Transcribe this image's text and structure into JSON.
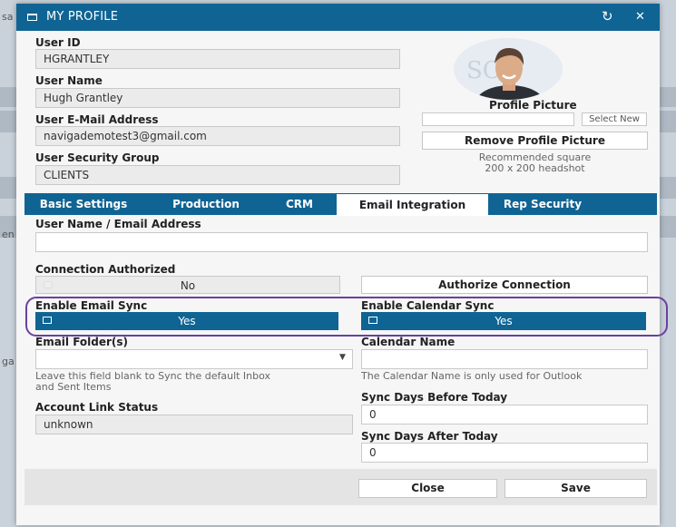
{
  "background": {
    "ghost_text_1": "sa",
    "ghost_text_2": "en",
    "ghost_text_3": "ga"
  },
  "dialog": {
    "title": "MY PROFILE",
    "refresh_icon": "↻",
    "close_icon": "✕"
  },
  "profile": {
    "user_id_label": "User ID",
    "user_id": "HGRANTLEY",
    "user_name_label": "User Name",
    "user_name": "Hugh Grantley",
    "email_label": "User E-Mail Address",
    "email": "navigademotest3@gmail.com",
    "security_group_label": "User Security Group",
    "security_group": "CLIENTS"
  },
  "picture": {
    "label": "Profile Picture",
    "select_new": "Select New",
    "remove_button": "Remove Profile Picture",
    "hint_line1": "Recommended square",
    "hint_line2": "200 x 200 headshot"
  },
  "tabs": [
    {
      "label": "Basic Settings"
    },
    {
      "label": "Production"
    },
    {
      "label": "CRM"
    },
    {
      "label": "Email Integration"
    },
    {
      "label": "Rep Security"
    }
  ],
  "email_integration": {
    "username_email_label": "User Name / Email Address",
    "username_email_value": "",
    "connection_authorized_label": "Connection Authorized",
    "connection_authorized_value": "No",
    "authorize_button": "Authorize Connection",
    "enable_email_sync_label": "Enable Email Sync",
    "enable_email_sync_value": "Yes",
    "enable_calendar_sync_label": "Enable Calendar Sync",
    "enable_calendar_sync_value": "Yes",
    "email_folders_label": "Email Folder(s)",
    "email_folders_value": "",
    "email_folders_hint_line1": "Leave this field blank to Sync the default Inbox",
    "email_folders_hint_line2": "and Sent Items",
    "calendar_name_label": "Calendar Name",
    "calendar_name_value": "",
    "calendar_name_hint": "The Calendar Name is only used for Outlook",
    "account_link_status_label": "Account Link Status",
    "account_link_status_value": "unknown",
    "sync_days_before_label": "Sync Days Before Today",
    "sync_days_before_value": "0",
    "sync_days_after_label": "Sync Days After Today",
    "sync_days_after_value": "0"
  },
  "footer": {
    "close_button": "Close",
    "save_button": "Save"
  },
  "colors": {
    "accent": "#0f6494",
    "highlight": "#6b3fa0"
  }
}
